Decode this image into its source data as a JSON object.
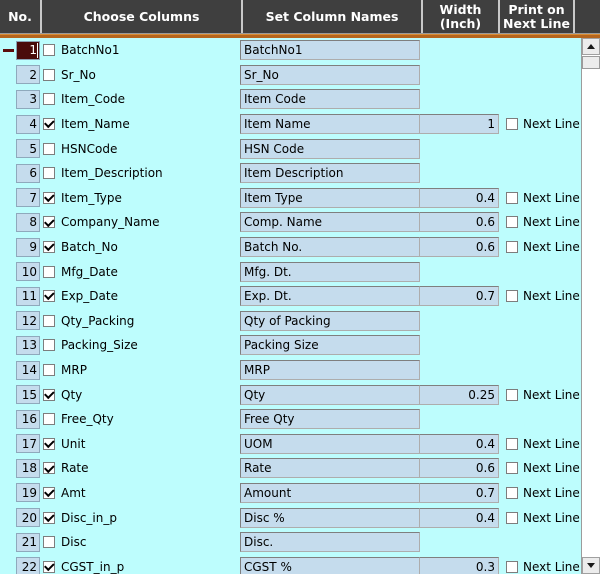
{
  "header": {
    "columns": [
      {
        "label": "No."
      },
      {
        "label": "Choose Columns"
      },
      {
        "label": "Set Column Names"
      },
      {
        "label": "Width\n(Inch)"
      },
      {
        "label": "Print on\nNext Line"
      }
    ]
  },
  "next_line_label": "Next Line",
  "selected_row": 1,
  "colors": {
    "background": "#bdfdfd",
    "header_bg": "#3f3f3f",
    "header_text": "#ffffff",
    "field_bg": "#c5dced",
    "rule": "#b5651d",
    "selected_row_bg": "#4a0b0b"
  },
  "scrollbar": {
    "up_icon": "triangle-up-icon",
    "down_icon": "triangle-down-icon",
    "thumb_position": "top"
  },
  "rows": [
    {
      "no": "1",
      "column": "BatchNo1",
      "checked": false,
      "name": "BatchNo1",
      "width": "",
      "next_line": null,
      "selected": true
    },
    {
      "no": "2",
      "column": "Sr_No",
      "checked": false,
      "name": "Sr_No",
      "width": "",
      "next_line": null,
      "selected": false
    },
    {
      "no": "3",
      "column": "Item_Code",
      "checked": false,
      "name": "Item Code",
      "width": "",
      "next_line": null,
      "selected": false
    },
    {
      "no": "4",
      "column": "Item_Name",
      "checked": true,
      "name": "Item Name",
      "width": "1",
      "next_line": false,
      "selected": false
    },
    {
      "no": "5",
      "column": "HSNCode",
      "checked": false,
      "name": "HSN Code",
      "width": "",
      "next_line": null,
      "selected": false
    },
    {
      "no": "6",
      "column": "Item_Description",
      "checked": false,
      "name": "Item Description",
      "width": "",
      "next_line": null,
      "selected": false
    },
    {
      "no": "7",
      "column": "Item_Type",
      "checked": true,
      "name": "Item Type",
      "width": "0.4",
      "next_line": false,
      "selected": false
    },
    {
      "no": "8",
      "column": "Company_Name",
      "checked": true,
      "name": "Comp. Name",
      "width": "0.6",
      "next_line": false,
      "selected": false
    },
    {
      "no": "9",
      "column": "Batch_No",
      "checked": true,
      "name": "Batch No.",
      "width": "0.6",
      "next_line": false,
      "selected": false
    },
    {
      "no": "10",
      "column": "Mfg_Date",
      "checked": false,
      "name": "Mfg. Dt.",
      "width": "",
      "next_line": null,
      "selected": false
    },
    {
      "no": "11",
      "column": "Exp_Date",
      "checked": true,
      "name": "Exp. Dt.",
      "width": "0.7",
      "next_line": false,
      "selected": false
    },
    {
      "no": "12",
      "column": "Qty_Packing",
      "checked": false,
      "name": "Qty of Packing",
      "width": "",
      "next_line": null,
      "selected": false
    },
    {
      "no": "13",
      "column": "Packing_Size",
      "checked": false,
      "name": "Packing Size",
      "width": "",
      "next_line": null,
      "selected": false
    },
    {
      "no": "14",
      "column": "MRP",
      "checked": false,
      "name": "MRP",
      "width": "",
      "next_line": null,
      "selected": false
    },
    {
      "no": "15",
      "column": "Qty",
      "checked": true,
      "name": "Qty",
      "width": "0.25",
      "next_line": false,
      "selected": false
    },
    {
      "no": "16",
      "column": "Free_Qty",
      "checked": false,
      "name": "Free Qty",
      "width": "",
      "next_line": null,
      "selected": false
    },
    {
      "no": "17",
      "column": "Unit",
      "checked": true,
      "name": "UOM",
      "width": "0.4",
      "next_line": false,
      "selected": false
    },
    {
      "no": "18",
      "column": "Rate",
      "checked": true,
      "name": "Rate",
      "width": "0.6",
      "next_line": false,
      "selected": false
    },
    {
      "no": "19",
      "column": "Amt",
      "checked": true,
      "name": "Amount",
      "width": "0.7",
      "next_line": false,
      "selected": false
    },
    {
      "no": "20",
      "column": "Disc_in_p",
      "checked": true,
      "name": "Disc %",
      "width": "0.4",
      "next_line": false,
      "selected": false
    },
    {
      "no": "21",
      "column": "Disc",
      "checked": false,
      "name": "Disc.",
      "width": "",
      "next_line": null,
      "selected": false
    },
    {
      "no": "22",
      "column": "CGST_in_p",
      "checked": true,
      "name": "CGST %",
      "width": "0.3",
      "next_line": false,
      "selected": false
    }
  ]
}
